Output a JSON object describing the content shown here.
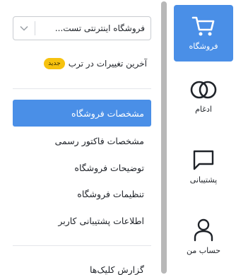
{
  "rail": {
    "items": [
      {
        "label": "فروشگاه",
        "icon": "cart-icon",
        "active": true
      },
      {
        "label": "ادغام",
        "icon": "interlocking-rings-icon"
      },
      {
        "label": "پشتیبانی",
        "icon": "chat-bubble-icon"
      },
      {
        "label": "حساب من",
        "icon": "user-icon"
      }
    ]
  },
  "store_select": {
    "value": "فروشگاه اینترنتی تست..."
  },
  "recent_changes": {
    "label": "آخرین تغییرات در ترب",
    "badge": "جدید"
  },
  "menu": {
    "items": [
      {
        "label": "مشخصات فروشگاه",
        "active": true
      },
      {
        "label": "مشخصات فاکتور رسمی"
      },
      {
        "label": "توضیحات فروشگاه"
      },
      {
        "label": "تنظیمات فروشگاه"
      },
      {
        "label": "اطلاعات پشتیبانی کاربر"
      }
    ],
    "secondary": [
      {
        "label": "گزارش کلیک‌ها"
      }
    ]
  },
  "colors": {
    "accent": "#4a8fe7",
    "badge": "#f6c20f"
  }
}
